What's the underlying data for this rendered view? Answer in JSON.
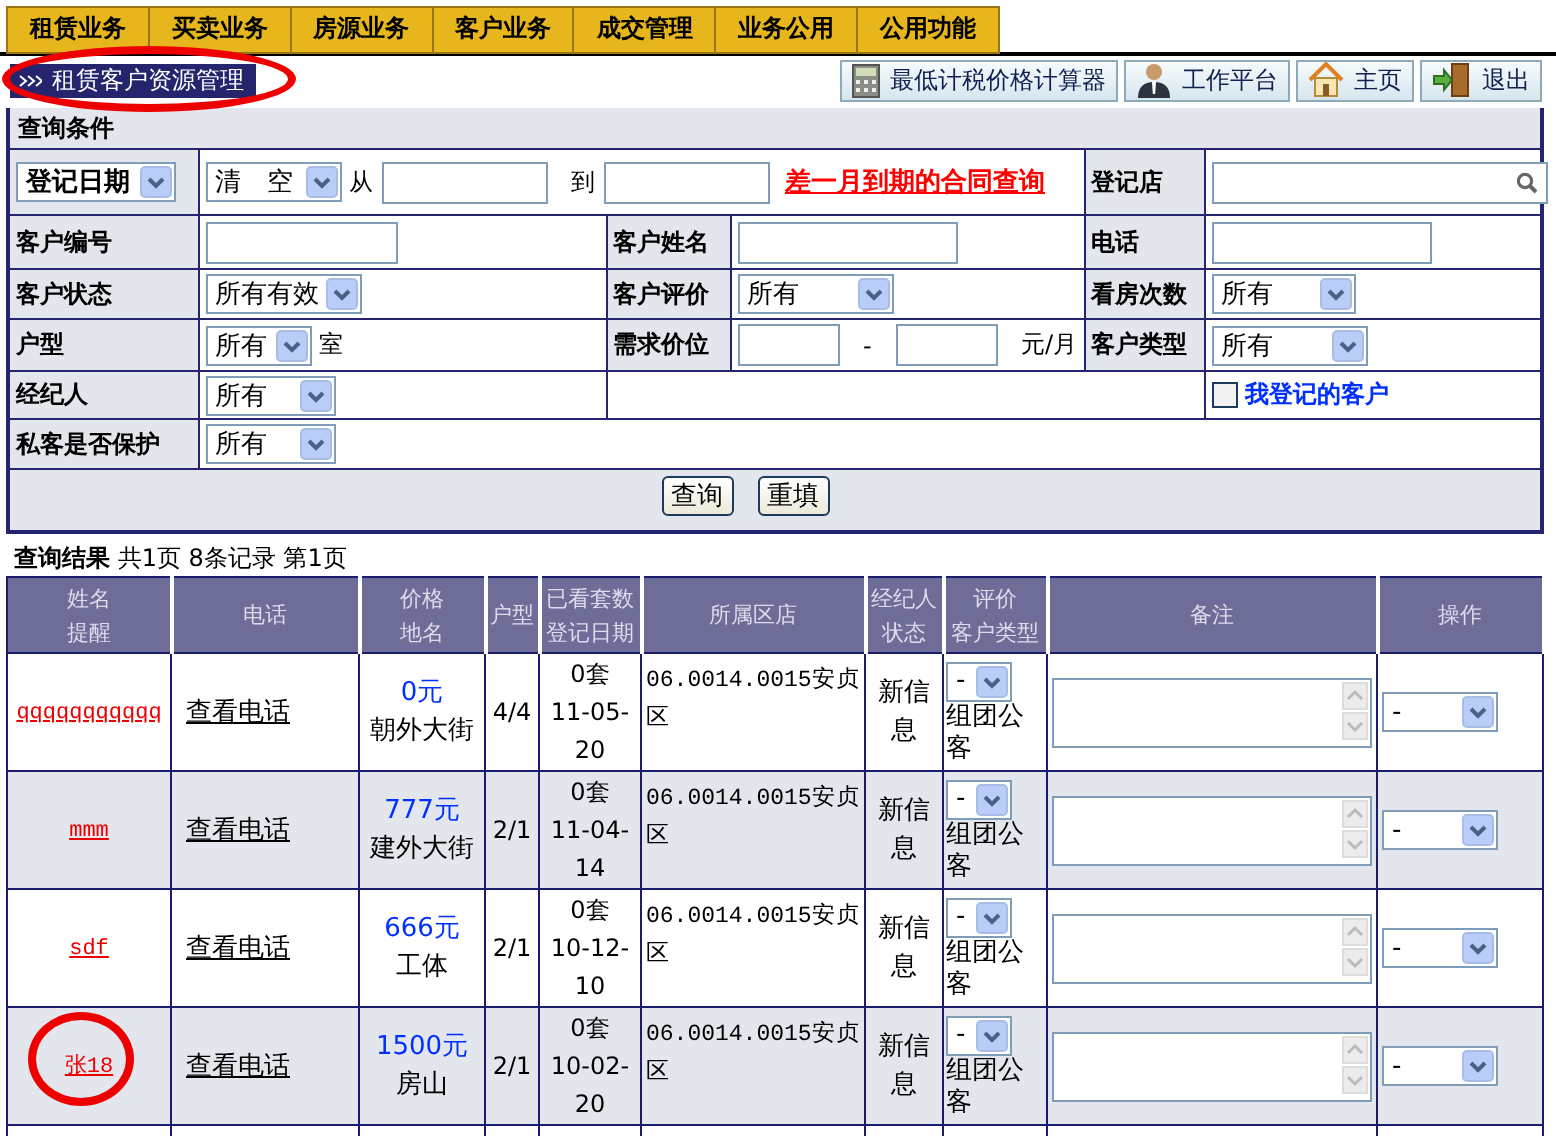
{
  "menu": [
    "租赁业务",
    "买卖业务",
    "房源业务",
    "客户业务",
    "成交管理",
    "业务公用",
    "公用功能"
  ],
  "page_title": {
    "text": "租赁客户资源管理",
    "circled": true
  },
  "toolbar": [
    {
      "kind": "calculator",
      "label": "最低计税价格计算器"
    },
    {
      "kind": "workbench",
      "label": "工作平台"
    },
    {
      "kind": "home",
      "label": "主页"
    },
    {
      "kind": "exit",
      "label": "退出"
    }
  ],
  "query": {
    "title": "查询条件",
    "date_type": "登记日期",
    "date_preset": "清　空",
    "from_label": "从",
    "to_label": "到",
    "expiring_link": "差一月到期的合同查询",
    "store_label": "登记店",
    "client_no_label": "客户编号",
    "client_name_label": "客户姓名",
    "phone_label": "电话",
    "status_label": "客户状态",
    "status_value": "所有有效",
    "rating_label": "客户评价",
    "rating_value": "所有",
    "visits_label": "看房次数",
    "visits_value": "所有",
    "layout_label": "户型",
    "layout_value": "所有",
    "layout_unit": "室",
    "price_label": "需求价位",
    "price_sep": "-",
    "price_unit": "元/月",
    "type_label": "客户类型",
    "type_value": "所有",
    "agent_label": "经纪人",
    "agent_value": "所有",
    "my_clients": {
      "label": "我登记的客户",
      "checked": false
    },
    "protect_label": "私客是否保护",
    "protect_value": "所有",
    "buttons": [
      "查询",
      "重填"
    ]
  },
  "results": {
    "title": "查询结果",
    "summary": "共1页 8条记录 第1页",
    "columns": [
      [
        "姓名",
        "提醒"
      ],
      [
        "电话"
      ],
      [
        "价格",
        "地名"
      ],
      [
        "户型"
      ],
      [
        "已看套数",
        "登记日期"
      ],
      [
        "所属区店"
      ],
      [
        "经纪人",
        "状态"
      ],
      [
        "评价",
        "客户类型"
      ],
      [
        "备注"
      ],
      [
        "操作"
      ]
    ],
    "rows": [
      {
        "name": "qqqqqqqqqqq",
        "phone": "查看电话",
        "price": "0元",
        "place": "朝外大街",
        "layout": "4/4",
        "viewed": "0套",
        "date": "11-05-20",
        "store": "06.0014.0015安贞区",
        "status": "新信息",
        "rating": "-",
        "client_type": "组团公客",
        "action": "-",
        "circled": false
      },
      {
        "name": "mmm",
        "phone": "查看电话",
        "price": "777元",
        "place": "建外大街",
        "layout": "2/1",
        "viewed": "0套",
        "date": "11-04-14",
        "store": "06.0014.0015安贞区",
        "status": "新信息",
        "rating": "-",
        "client_type": "组团公客",
        "action": "-",
        "circled": false
      },
      {
        "name": "sdf",
        "phone": "查看电话",
        "price": "666元",
        "place": "工体",
        "layout": "2/1",
        "viewed": "0套",
        "date": "10-12-10",
        "store": "06.0014.0015安贞区",
        "status": "新信息",
        "rating": "-",
        "client_type": "组团公客",
        "action": "-",
        "circled": false
      },
      {
        "name": "张18",
        "phone": "查看电话",
        "price": "1500元",
        "place": "房山",
        "layout": "2/1",
        "viewed": "0套",
        "date": "10-02-20",
        "store": "06.0014.0015安贞区",
        "status": "新信息",
        "rating": "-",
        "client_type": "组团公客",
        "action": "-",
        "circled": true
      }
    ]
  }
}
